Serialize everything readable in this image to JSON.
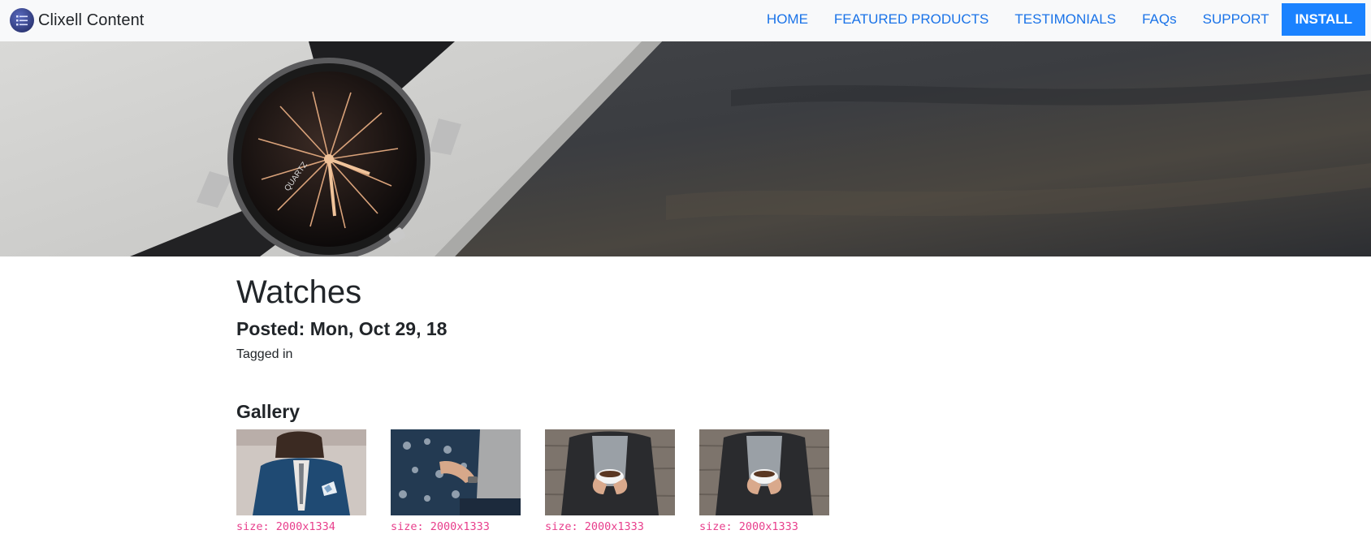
{
  "navbar": {
    "brand": "Clixell Content",
    "links": [
      "HOME",
      "FEATURED PRODUCTS",
      "TESTIMONIALS",
      "FAQs",
      "SUPPORT"
    ],
    "install_label": "INSTALL",
    "accent": "#1a73e8",
    "button_color": "#1a82ff"
  },
  "hero": {
    "image": "wristwatch-on-table"
  },
  "post": {
    "title": "Watches",
    "posted": "Posted: Mon, Oct 29, 18",
    "tagged": "Tagged in"
  },
  "gallery": {
    "title": "Gallery",
    "items": [
      {
        "image": "man-in-blue-suit",
        "size": "size: 2000x1334"
      },
      {
        "image": "man-in-patterned-shirt",
        "size": "size: 2000x1333"
      },
      {
        "image": "man-holding-coffee-cup",
        "size": "size: 2000x1333"
      },
      {
        "image": "man-holding-coffee-cup",
        "size": "size: 2000x1333"
      }
    ],
    "size_color": "#e83e8c"
  }
}
